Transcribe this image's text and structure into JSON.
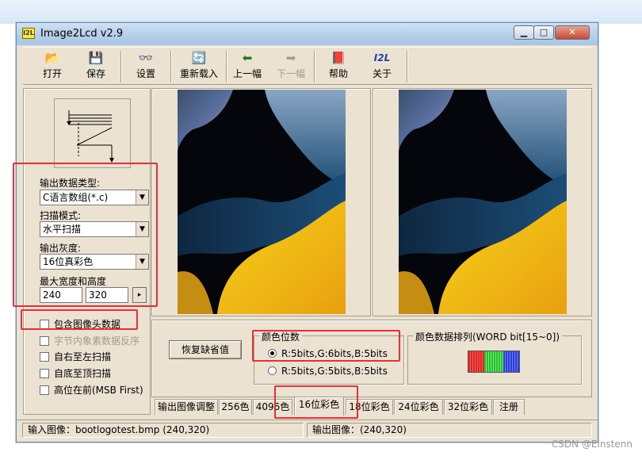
{
  "window": {
    "title": "Image2Lcd v2.9",
    "icon_text": "I2L",
    "min": "▁",
    "max": "□",
    "close": "✕"
  },
  "toolbar": [
    {
      "label": "打开",
      "icon": "open-folder-icon",
      "glyph": "📂",
      "disabled": false
    },
    {
      "label": "保存",
      "icon": "save-disk-icon",
      "glyph": "💾",
      "disabled": false
    },
    {
      "label": "设置",
      "icon": "glasses-icon",
      "glyph": "👓",
      "disabled": false
    },
    {
      "label": "重新载入",
      "icon": "reload-icon",
      "glyph": "🔄",
      "disabled": false
    },
    {
      "label": "上一幅",
      "icon": "arrow-left-icon",
      "glyph": "⬅",
      "disabled": false
    },
    {
      "label": "下一幅",
      "icon": "arrow-right-icon",
      "glyph": "➡",
      "disabled": true
    },
    {
      "label": "帮助",
      "icon": "help-book-icon",
      "glyph": "📕",
      "disabled": false
    },
    {
      "label": "关于",
      "icon": "about-logo-icon",
      "glyph": "I2L",
      "disabled": false
    }
  ],
  "settings": {
    "output_type_label": "输出数据类型:",
    "output_type_value": "C语言数组(*.c)",
    "scan_mode_label": "扫描模式:",
    "scan_mode_value": "水平扫描",
    "gray_label": "输出灰度:",
    "gray_value": "16位真彩色",
    "size_label": "最大宽度和高度",
    "width": "240",
    "height": "320",
    "lock_arrow": "▸"
  },
  "checkboxes": [
    {
      "label": "包含图像头数据",
      "checked": false,
      "disabled": false
    },
    {
      "label": "字节内象素数据反序",
      "checked": false,
      "disabled": true
    },
    {
      "label": "自右至左扫描",
      "checked": false,
      "disabled": false
    },
    {
      "label": "自底至顶扫描",
      "checked": false,
      "disabled": false
    },
    {
      "label": "高位在前(MSB First)",
      "checked": false,
      "disabled": false
    }
  ],
  "bottom": {
    "restore_button": "恢复缺省值",
    "color_bits_legend": "颜色位数",
    "radio_565": "R:5bits,G:6bits,B:5bits",
    "radio_555": "R:5bits,G:5bits,B:5bits",
    "selected_radio": "565",
    "word_order_legend": "颜色数据排列(WORD bit[15~0])",
    "colors": {
      "red": "#e02525",
      "green": "#22c22a",
      "blue": "#2a3ee0"
    }
  },
  "tabs": [
    "输出图像调整",
    "256色",
    "4096色",
    "16位彩色",
    "18位彩色",
    "24位彩色",
    "32位彩色",
    "注册"
  ],
  "active_tab": "16位彩色",
  "status": {
    "input": "输入图像：bootlogotest.bmp (240,320)",
    "output": "输出图像：(240,320)"
  },
  "watermark": "CSDN @Einstenn"
}
